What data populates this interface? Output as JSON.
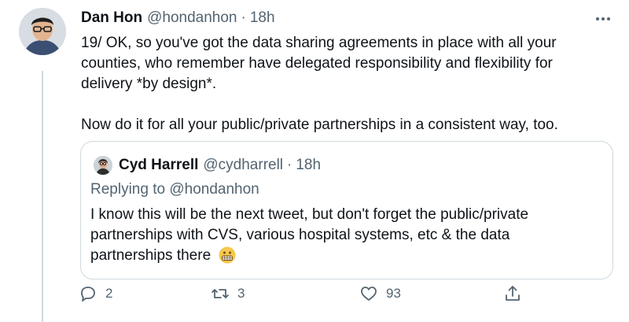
{
  "tweet": {
    "author_name": "Dan Hon",
    "handle": "@hondanhon",
    "separator": "·",
    "time": "18h",
    "text_lines": [
      "19/ OK, so you've got the data sharing agreements in place with all your",
      "counties, who remember have delegated responsibility and flexibility for",
      "delivery *by design*."
    ],
    "text_lines_2": [
      "Now do it for all your public/private partnerships in a consistent way, too."
    ]
  },
  "quote": {
    "author_name": "Cyd Harrell",
    "handle": "@cydharrell",
    "separator": "·",
    "time": "18h",
    "replying_to": "Replying to @hondanhon",
    "text_lines": [
      "I know this will be the next tweet, but don't forget the public/private",
      "partnerships with CVS, various hospital systems, etc & the data",
      "partnerships there"
    ],
    "emoji_icon": "grimacing-face-icon"
  },
  "actions": {
    "reply_count": "2",
    "retweet_count": "3",
    "like_count": "93"
  },
  "colors": {
    "text": "#0f1419",
    "muted": "#536471",
    "border": "#cfd9de"
  }
}
